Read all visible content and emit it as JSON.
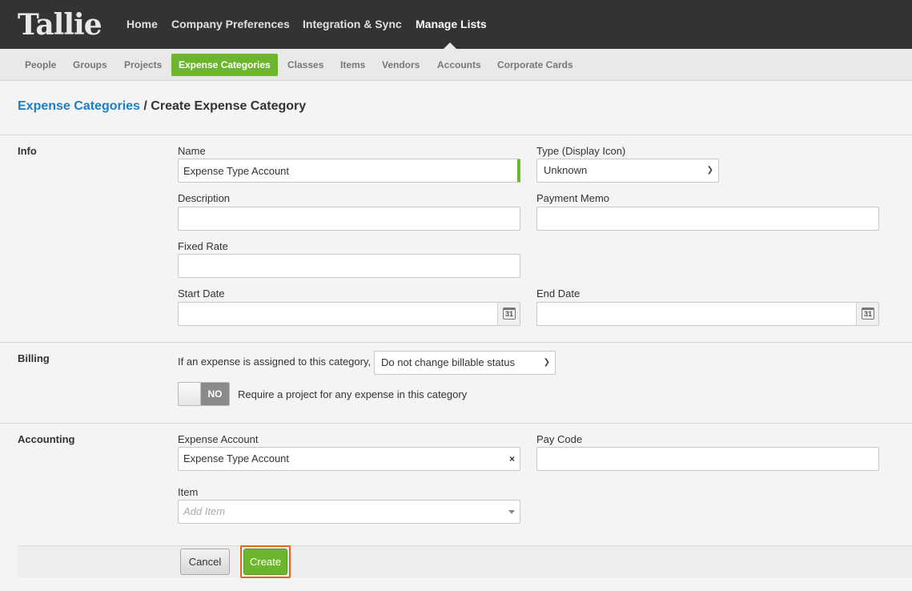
{
  "brand": {
    "logo_text": "Tallie"
  },
  "topnav": {
    "items": [
      "Home",
      "Company Preferences",
      "Integration & Sync",
      "Manage Lists"
    ],
    "active": "Manage Lists"
  },
  "subnav": {
    "items": [
      "People",
      "Groups",
      "Projects",
      "Expense Categories",
      "Classes",
      "Items",
      "Vendors",
      "Accounts",
      "Corporate Cards"
    ],
    "active": "Expense Categories"
  },
  "breadcrumb": {
    "parent": "Expense Categories",
    "separator": " / ",
    "current": "Create Expense Category"
  },
  "sections": {
    "info": "Info",
    "billing": "Billing",
    "accounting": "Accounting"
  },
  "info": {
    "name_label": "Name",
    "name_value": "Expense Type Account",
    "type_label": "Type (Display Icon)",
    "type_value": "Unknown",
    "description_label": "Description",
    "description_value": "",
    "payment_memo_label": "Payment Memo",
    "payment_memo_value": "",
    "fixed_rate_label": "Fixed Rate",
    "fixed_rate_value": "",
    "start_date_label": "Start Date",
    "start_date_value": "",
    "end_date_label": "End Date",
    "end_date_value": "",
    "calendar_day": "31"
  },
  "billing": {
    "prompt": "If an expense is assigned to this category,",
    "billable_value": "Do not change billable status",
    "toggle_state": "NO",
    "toggle_text": "Require a project for any expense in this category"
  },
  "accounting": {
    "expense_account_label": "Expense Account",
    "expense_account_value": "Expense Type Account",
    "clear_glyph": "×",
    "pay_code_label": "Pay Code",
    "pay_code_value": "",
    "item_label": "Item",
    "item_placeholder": "Add Item"
  },
  "actions": {
    "cancel": "Cancel",
    "create": "Create"
  },
  "colors": {
    "accent_green": "#6cb52d",
    "link_blue": "#1c7fc6",
    "topbar": "#333333",
    "highlight_orange": "#e0661c"
  }
}
